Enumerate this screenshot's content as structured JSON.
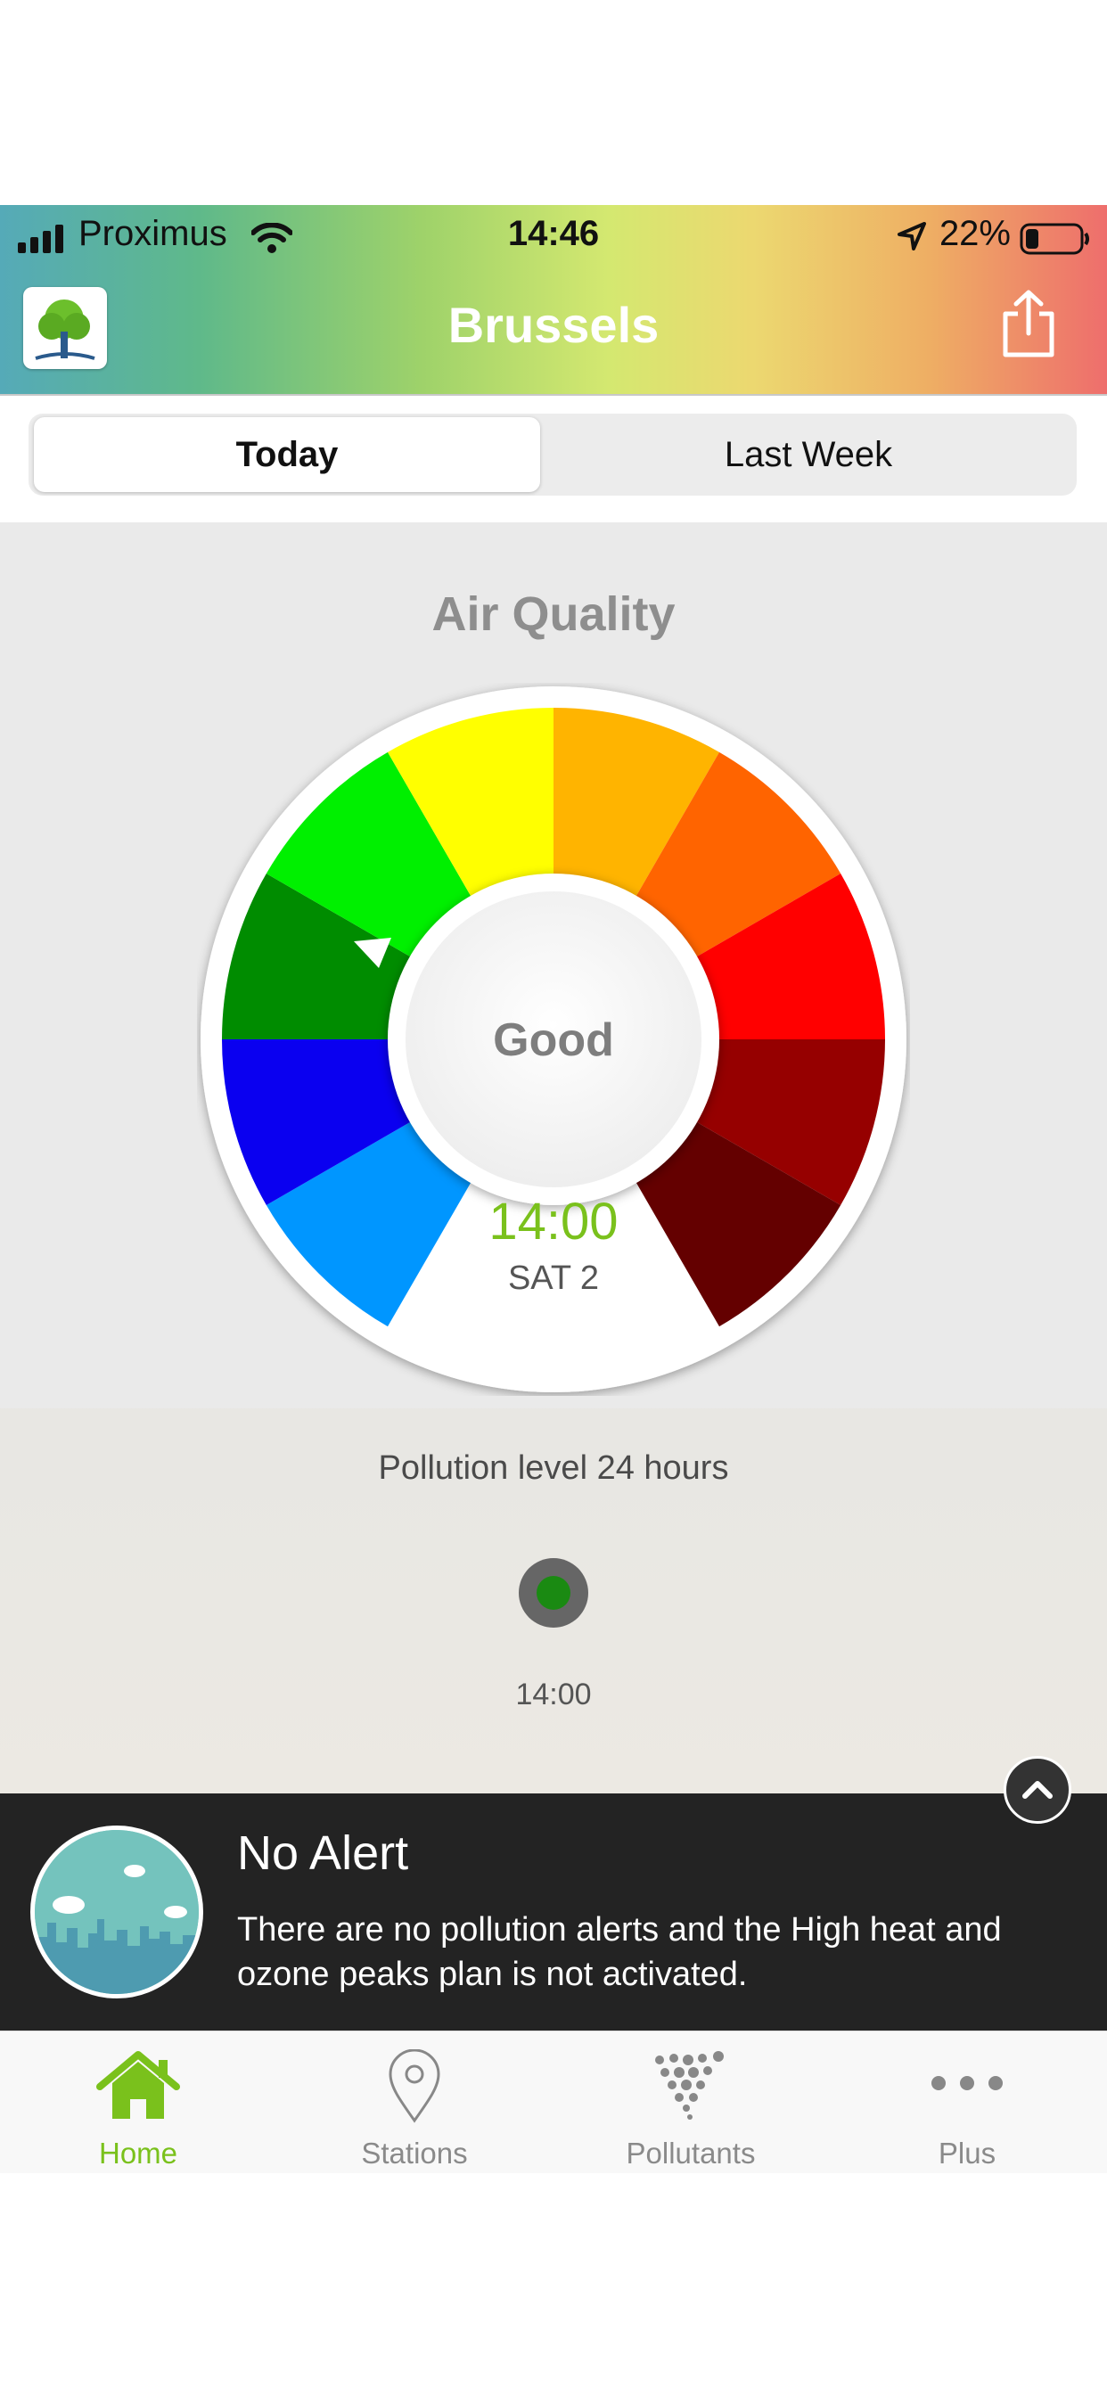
{
  "status_bar": {
    "carrier": "Proximus",
    "time": "14:46",
    "battery": "22%"
  },
  "header": {
    "title": "Brussels"
  },
  "segments": [
    {
      "label": "Today",
      "active": true
    },
    {
      "label": "Last Week",
      "active": false
    }
  ],
  "gauge": {
    "title": "Air Quality",
    "status": "Good",
    "time": "14:00",
    "day": "SAT 2",
    "colors": [
      "#0096ff",
      "#0a00f0",
      "#008c00",
      "#00f000",
      "#ffff00",
      "#ffb400",
      "#ff6400",
      "#ff0000",
      "#960000",
      "#640000"
    ],
    "accent": "#7ac11c"
  },
  "pollution": {
    "title": "Pollution level 24 hours",
    "time_label": "14:00",
    "level_color": "#1a8a12"
  },
  "alert": {
    "title": "No Alert",
    "text": "There are no pollution alerts and the High heat and ozone peaks plan is not activated."
  },
  "tabs": [
    {
      "label": "Home",
      "icon": "home-icon",
      "active": true
    },
    {
      "label": "Stations",
      "icon": "map-pin-icon",
      "active": false
    },
    {
      "label": "Pollutants",
      "icon": "particles-icon",
      "active": false
    },
    {
      "label": "Plus",
      "icon": "more-icon",
      "active": false
    }
  ]
}
